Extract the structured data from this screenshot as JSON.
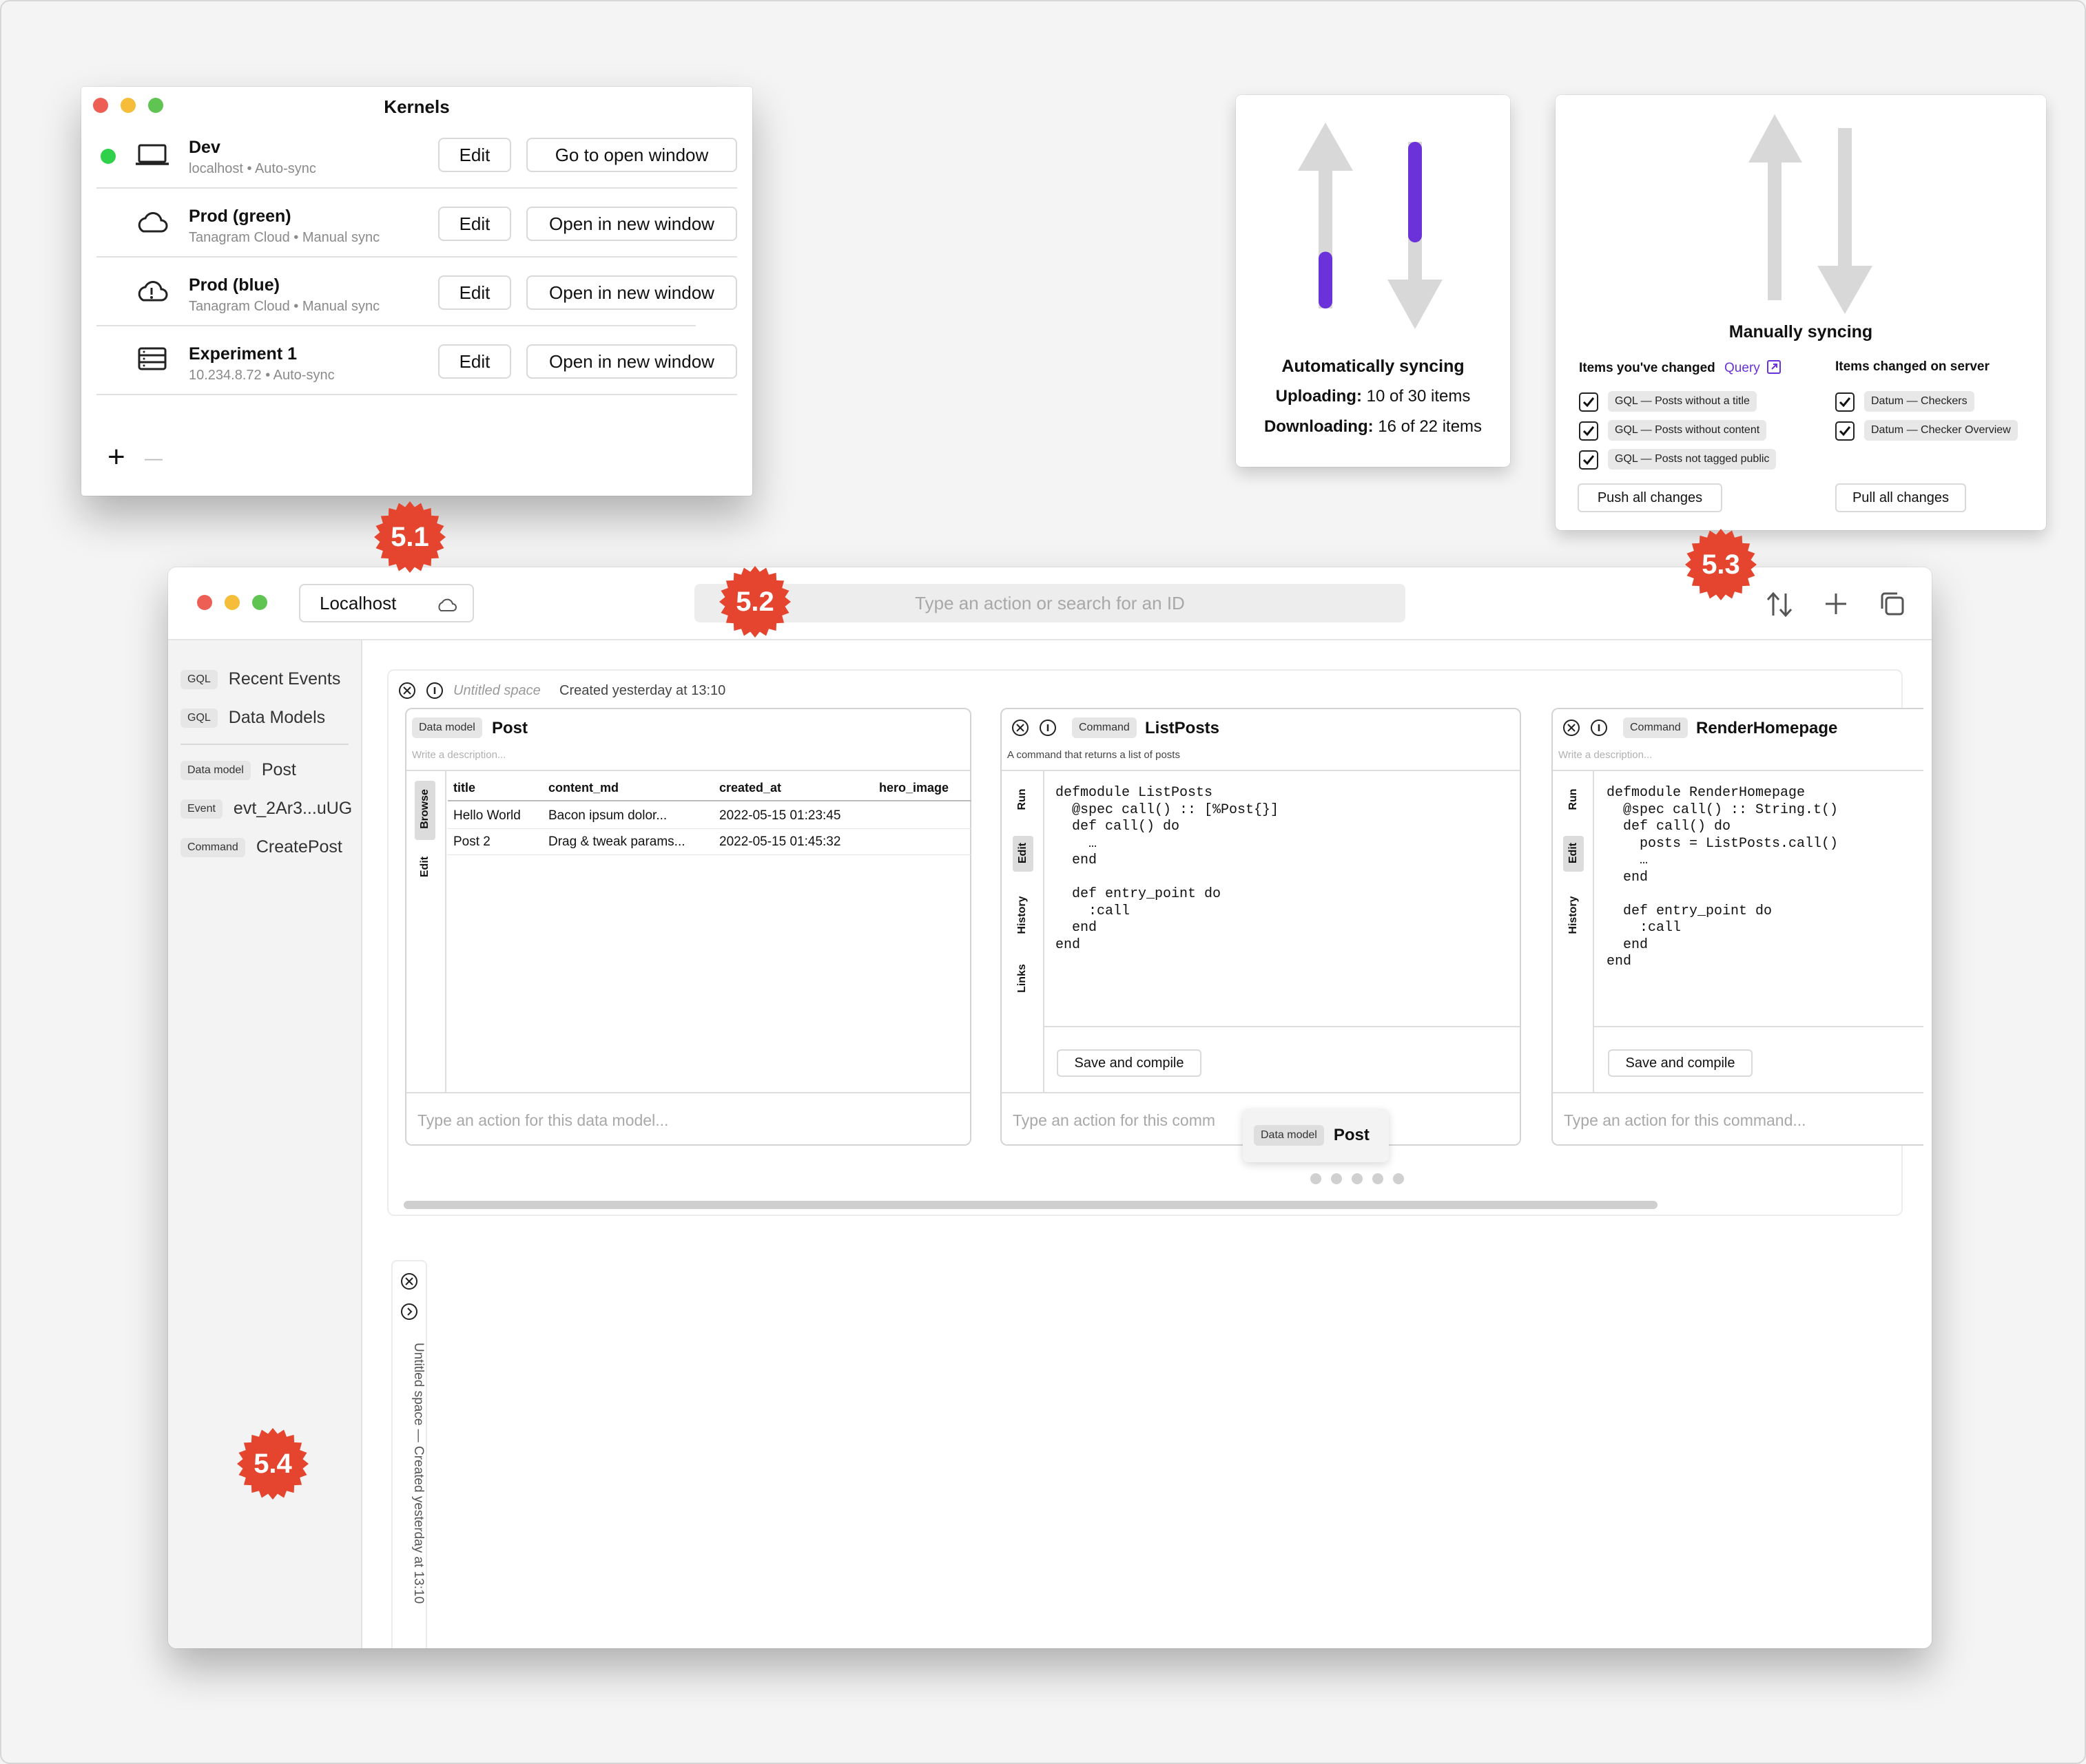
{
  "kernels": {
    "title": "Kernels",
    "items": [
      {
        "name": "Dev",
        "meta": "localhost • Auto-sync",
        "status": "connected",
        "icon": "laptop-icon",
        "edit": "Edit",
        "action": "Go to open window"
      },
      {
        "name": "Prod (green)",
        "meta": "Tanagram Cloud • Manual sync",
        "icon": "cloud-icon",
        "edit": "Edit",
        "action": "Open in new window"
      },
      {
        "name": "Prod (blue)",
        "meta": "Tanagram Cloud • Manual sync",
        "icon": "cloud-warning-icon",
        "edit": "Edit",
        "action": "Open in new window"
      },
      {
        "name": "Experiment 1",
        "meta": "10.234.8.72 • Auto-sync",
        "icon": "server-icon",
        "edit": "Edit",
        "action": "Open in new window"
      }
    ],
    "add": "+",
    "remove": "—"
  },
  "badges": {
    "b1": "5.1",
    "b2": "5.2",
    "b3": "5.3",
    "b4": "5.4"
  },
  "auto_sync": {
    "title": "Automatically syncing",
    "up_label": "Uploading:",
    "up_value": "10 of 30 items",
    "down_label": "Downloading:",
    "down_value": "16 of 22 items",
    "upload_progress": 0.33,
    "download_progress": 0.73,
    "accent": "#6a32d8"
  },
  "manual_sync": {
    "title": "Manually syncing",
    "left_header": "Items you've changed",
    "query": "Query",
    "right_header": "Items changed on server",
    "left_items": [
      "GQL — Posts without a title",
      "GQL — Posts without content",
      "GQL — Posts not tagged public"
    ],
    "right_items": [
      "Datum — Checkers",
      "Datum — Checker Overview"
    ],
    "push": "Push all changes",
    "pull": "Pull all changes"
  },
  "main": {
    "kernel": "Localhost",
    "search_placeholder": "Type an action or search for an ID",
    "sidebar": [
      {
        "tag": "GQL",
        "label": "Recent Events"
      },
      {
        "tag": "GQL",
        "label": "Data Models"
      },
      {
        "tag": "Data model",
        "label": "Post"
      },
      {
        "tag": "Event",
        "label": "evt_2Ar3...uUG"
      },
      {
        "tag": "Command",
        "label": "CreatePost"
      }
    ],
    "space": {
      "name": "Untitled space",
      "created": "Created yesterday at 13:10"
    },
    "post": {
      "tag": "Data model",
      "title": "Post",
      "desc": "Write a description...",
      "tabs": [
        "Browse",
        "Edit"
      ],
      "columns": [
        "title",
        "content_md",
        "created_at",
        "hero_image"
      ],
      "rows": [
        [
          "Hello World",
          "Bacon ipsum dolor...",
          "2022-05-15 01:23:45",
          ""
        ],
        [
          "Post 2",
          "Drag & tweak params...",
          "2022-05-15 01:45:32",
          ""
        ]
      ],
      "action_placeholder": "Type an action for this data model..."
    },
    "listposts": {
      "tag": "Command",
      "title": "ListPosts",
      "desc": "A command that returns a list of posts",
      "tabs": [
        "Run",
        "Edit",
        "History",
        "Links"
      ],
      "code": [
        "defmodule ListPosts",
        "  @spec call() :: [%Post{}]",
        "  def call() do",
        "    …",
        "  end",
        "",
        "  def entry_point do",
        "    :call",
        "  end",
        "end"
      ],
      "save": "Save and compile",
      "action_placeholder": "Type an action for this comm"
    },
    "render": {
      "tag": "Command",
      "title": "RenderHomepage",
      "desc": "Write a description...",
      "tabs": [
        "Run",
        "Edit",
        "History"
      ],
      "code": [
        "defmodule RenderHomepage",
        "  @spec call() :: String.t()",
        "  def call() do",
        "    posts = ListPosts.call()",
        "    …",
        "  end",
        "",
        "  def entry_point do",
        "    :call",
        "  end",
        "end"
      ],
      "save": "Save and compile",
      "action_placeholder": "Type an action for this command..."
    },
    "tooltip": {
      "tag": "Data model",
      "title": "Post"
    },
    "collapsed_space": "Untitled space — Created yesterday at 13:10"
  }
}
